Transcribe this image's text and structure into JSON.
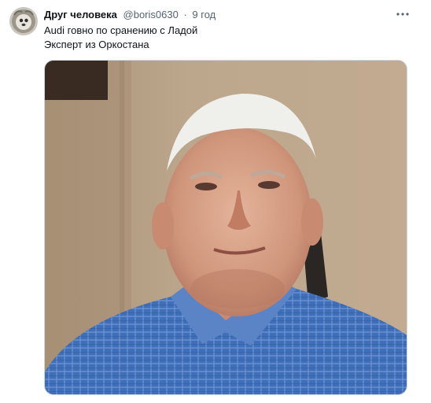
{
  "tweet": {
    "author_name": "Друг человека",
    "handle": "@boris0630",
    "separator": "·",
    "time": "9 год",
    "text_lines": [
      "Audi говно по сранению с Ладой",
      "Эксперт из Оркостана"
    ],
    "avatar_icon": "avatar-photo",
    "more_icon": "more-dots-icon"
  },
  "colors": {
    "text_primary": "#0f1419",
    "text_secondary": "#536471",
    "media_border": "#cfd9de",
    "shirt": "#3f6fb8",
    "wall": "#b59f86"
  }
}
